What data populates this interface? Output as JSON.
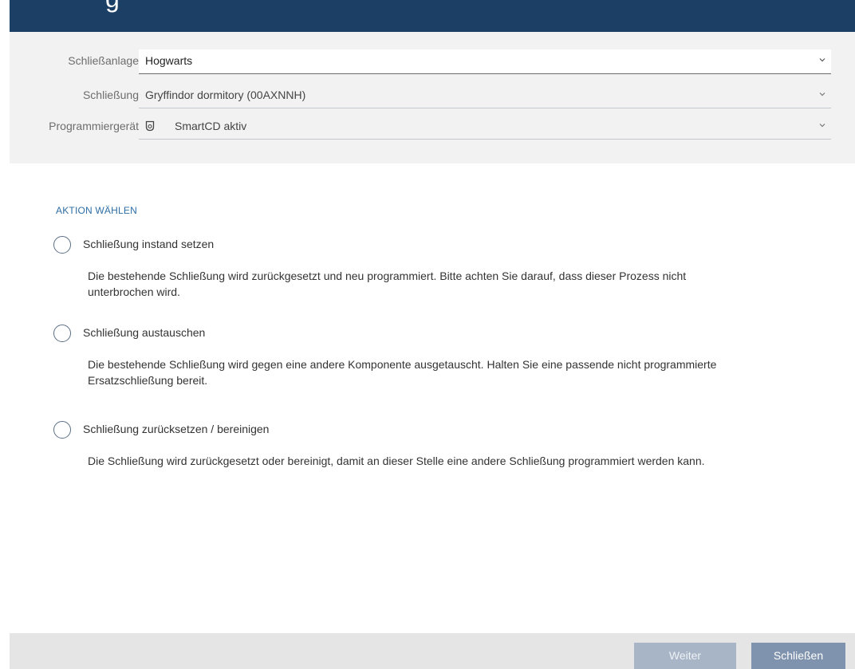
{
  "titlebar": {
    "title": "g"
  },
  "form": {
    "locking_system": {
      "label": "Schließanlage",
      "value": "Hogwarts"
    },
    "lock": {
      "label": "Schließung",
      "value": "Gryffindor dormitory (00AXNNH)"
    },
    "programmer": {
      "label": "Programmiergerät",
      "value": "SmartCD aktiv",
      "icon": "smartcd-device-icon"
    }
  },
  "actions": {
    "section_title": "AKTION WÄHLEN",
    "options": [
      {
        "label": "Schließung instand setzen",
        "description": "Die bestehende Schließung wird zurückgesetzt und neu programmiert. Bitte achten Sie darauf, dass dieser Prozess nicht unterbrochen wird.",
        "selected": false
      },
      {
        "label": "Schließung austauschen",
        "description": "Die bestehende Schließung wird gegen eine andere Komponente ausgetauscht. Halten Sie eine passende nicht programmierte Ersatzschließung bereit.",
        "selected": false
      },
      {
        "label": "Schließung zurücksetzen / bereinigen",
        "description": "Die Schließung wird zurückgesetzt oder bereinigt, damit an dieser Stelle eine andere Schließung programmiert werden kann.",
        "selected": false
      }
    ]
  },
  "footer": {
    "next_label": "Weiter",
    "close_label": "Schließen"
  },
  "colors": {
    "titlebar": "#1c3f66",
    "accent": "#2e6da4",
    "button_disabled": "#a8b5c6",
    "button_primary": "#7f93ae"
  }
}
